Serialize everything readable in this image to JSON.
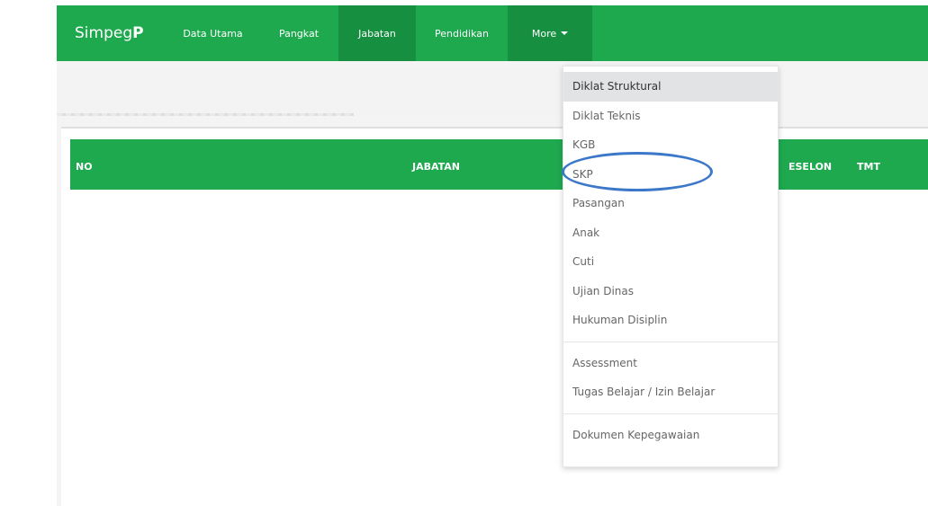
{
  "navbar": {
    "brand_text": "Simpeg",
    "brand_bold": "P",
    "items": [
      {
        "label": "Data Utama"
      },
      {
        "label": "Pangkat"
      },
      {
        "label": "Jabatan"
      },
      {
        "label": "Pendidikan"
      },
      {
        "label": "More"
      }
    ],
    "active_color": "#178f40",
    "bg_color": "#1ea94f"
  },
  "table": {
    "headers": [
      "NO",
      "JABATAN",
      "ESELON",
      "TMT"
    ]
  },
  "dropdown": {
    "group1": [
      {
        "label": "Diklat Struktural"
      },
      {
        "label": "Diklat Teknis"
      },
      {
        "label": "KGB"
      },
      {
        "label": "SKP"
      },
      {
        "label": "Pasangan"
      },
      {
        "label": "Anak"
      },
      {
        "label": "Cuti"
      },
      {
        "label": "Ujian Dinas"
      },
      {
        "label": "Hukuman Disiplin"
      }
    ],
    "group2": [
      {
        "label": "Assessment"
      },
      {
        "label": "Tugas Belajar / Izin Belajar"
      }
    ],
    "group3": [
      {
        "label": "Dokumen Kepegawaian"
      }
    ]
  },
  "annotation": {
    "color": "#3b78c9"
  }
}
